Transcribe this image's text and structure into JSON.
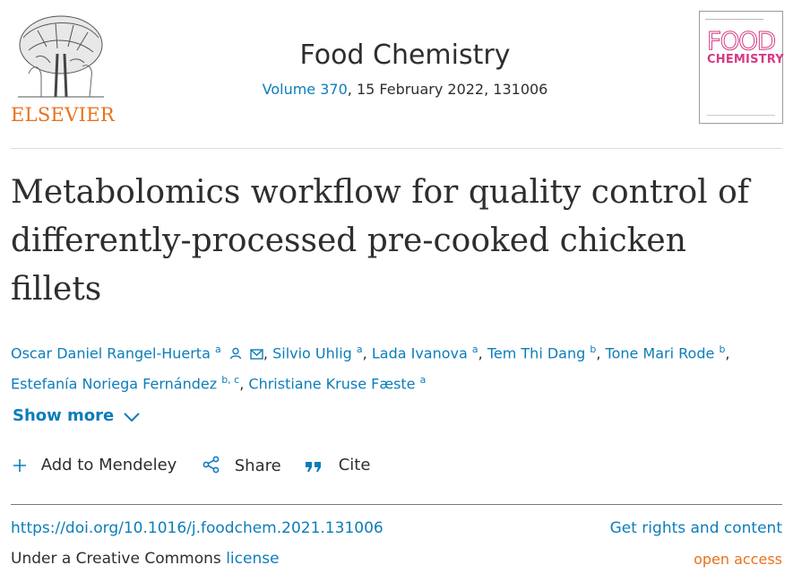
{
  "publisher": {
    "name": "ELSEVIER",
    "logo_icon": "elsevier-tree-logo"
  },
  "journal": {
    "title": "Food Chemistry",
    "volume_link": "Volume 370",
    "date_page": ", 15 February 2022, 131006",
    "cover": {
      "word1": "FOOD",
      "word2": "CHEMISTRY",
      "brand_color": "#d63a86"
    }
  },
  "article": {
    "title": "Metabolomics workflow for quality control of differently-processed pre-cooked chicken fillets",
    "authors": [
      {
        "name": "Oscar Daniel Rangel-Huerta",
        "sup": "a",
        "icons": [
          "person-icon",
          "email-icon"
        ]
      },
      {
        "name": "Silvio Uhlig",
        "sup": "a"
      },
      {
        "name": "Lada Ivanova",
        "sup": "a"
      },
      {
        "name": "Tem Thi Dang",
        "sup": "b"
      },
      {
        "name": "Tone Mari Rode",
        "sup": "b"
      },
      {
        "name": "Estefanía Noriega Fernández",
        "sup": "b, c"
      },
      {
        "name": "Christiane Kruse Fæste",
        "sup": "a"
      }
    ],
    "separator": ", ",
    "show_more": "Show more"
  },
  "actions": {
    "mendeley": "Add to Mendeley",
    "share": "Share",
    "cite": "Cite"
  },
  "footer": {
    "doi": "https://doi.org/10.1016/j.foodchem.2021.131006",
    "rights": "Get rights and content",
    "license_prefix": "Under a Creative Commons ",
    "license_link": "license",
    "open_access": "open access"
  },
  "colors": {
    "link": "#0c7dbb",
    "elsevier_orange": "#e9711c",
    "text": "#2e2e2e"
  }
}
